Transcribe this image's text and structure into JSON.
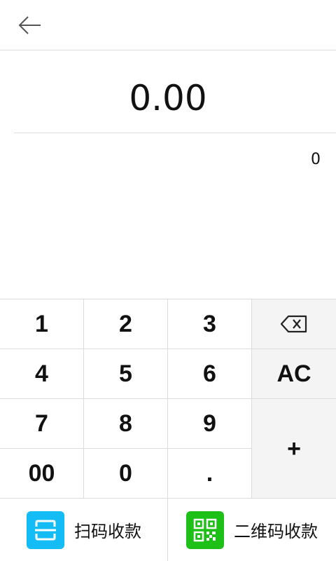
{
  "amount": {
    "value": "0.00",
    "expression": "0"
  },
  "keypad": {
    "keys": {
      "k1": "1",
      "k2": "2",
      "k3": "3",
      "k4": "4",
      "k5": "5",
      "k6": "6",
      "k7": "7",
      "k8": "8",
      "k9": "9",
      "k00": "00",
      "k0": "0",
      "dot": ".",
      "clear": "AC",
      "plus": "+"
    }
  },
  "payment": {
    "scan_label": "扫码收款",
    "qr_label": "二维码收款",
    "scan_color": "#13BCF5",
    "qr_color": "#1DC016"
  },
  "icons": {
    "back": "arrow-left-icon",
    "backspace": "backspace-icon",
    "scan": "scan-icon",
    "qr": "qr-code-icon"
  }
}
